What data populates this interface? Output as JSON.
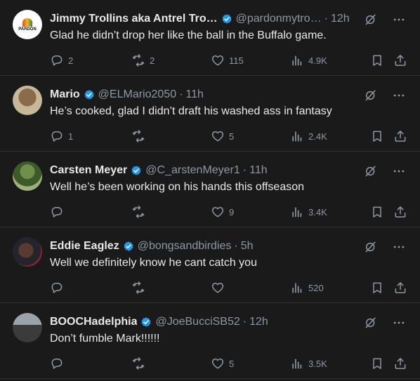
{
  "colors": {
    "background": "#1a1a1a",
    "text": "#e7e9ea",
    "muted": "#8b98a5",
    "verified": "#1d9bf0",
    "divider": "#2f3336"
  },
  "icons": [
    "reply-icon",
    "retweet-icon",
    "like-icon",
    "views-icon",
    "bookmark-icon",
    "share-icon",
    "grok-icon",
    "more-icon",
    "verified-icon"
  ],
  "replies": [
    {
      "name": "Jimmy Trollins aka Antrel Tro…",
      "handle": "@pardonmytro…",
      "time": "12h",
      "text": "Glad he didn’t drop her like the ball in the Buffalo game.",
      "reply_count": "2",
      "retweet_count": "2",
      "like_count": "115",
      "views": "4.9K",
      "avatar_text": "PARDON"
    },
    {
      "name": "Mario",
      "handle": "@ELMario2050",
      "time": "11h",
      "text": "He’s cooked, glad I didn’t draft his washed ass in fantasy",
      "reply_count": "1",
      "retweet_count": "",
      "like_count": "5",
      "views": "2.4K"
    },
    {
      "name": "Carsten Meyer",
      "handle": "@C_arstenMeyer1",
      "time": "11h",
      "text": "Well he’s been working on his hands this offseason",
      "reply_count": "",
      "retweet_count": "",
      "like_count": "9",
      "views": "3.4K"
    },
    {
      "name": "Eddie Eaglez",
      "handle": "@bongsandbirdies",
      "time": "5h",
      "text": "Well we definitely know he cant catch you",
      "reply_count": "",
      "retweet_count": "",
      "like_count": "",
      "views": "520"
    },
    {
      "name": "BOOCHadelphia",
      "handle": "@JoeBucciSB52",
      "time": "12h",
      "text": "Don’t fumble Mark!!!!!!",
      "reply_count": "",
      "retweet_count": "",
      "like_count": "5",
      "views": "3.5K"
    }
  ]
}
